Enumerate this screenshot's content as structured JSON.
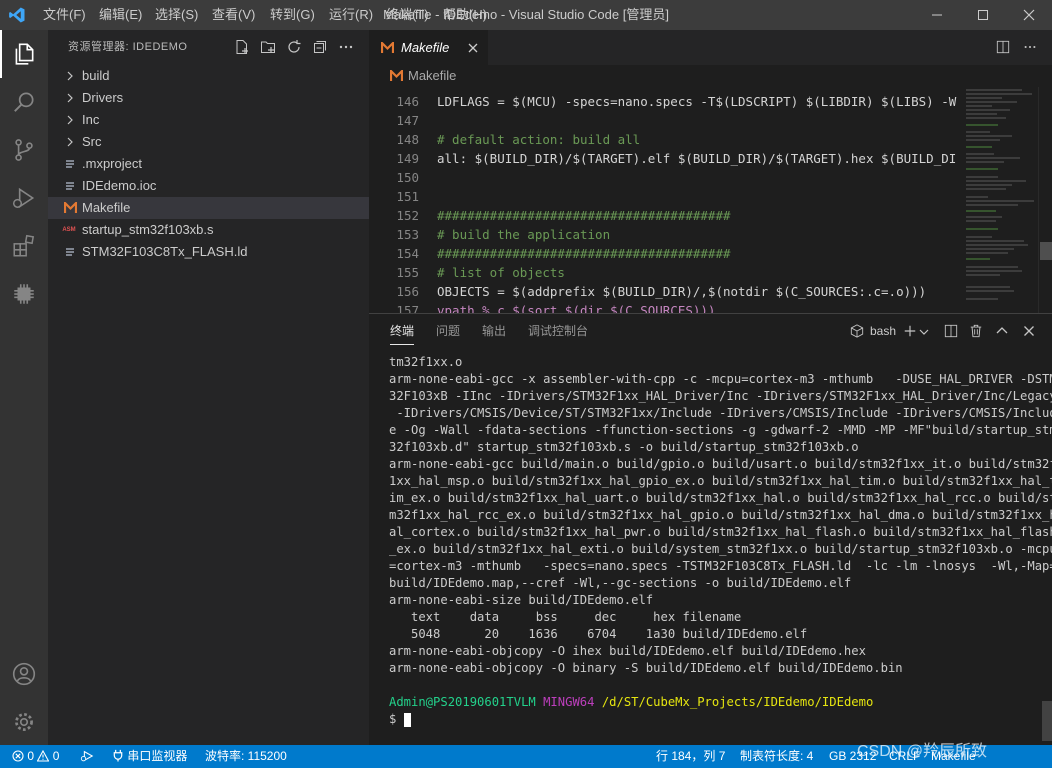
{
  "window": {
    "title": "Makefile - IDEdemo - Visual Studio Code [管理员]",
    "menu": [
      "文件(F)",
      "编辑(E)",
      "选择(S)",
      "查看(V)",
      "转到(G)",
      "运行(R)",
      "终端(T)",
      "帮助(H)"
    ]
  },
  "sidebar": {
    "title": "资源管理器: IDEDEMO",
    "items": [
      {
        "label": "build",
        "type": "folder"
      },
      {
        "label": "Drivers",
        "type": "folder"
      },
      {
        "label": "Inc",
        "type": "folder"
      },
      {
        "label": "Src",
        "type": "folder"
      },
      {
        "label": ".mxproject",
        "type": "file"
      },
      {
        "label": "IDEdemo.ioc",
        "type": "file"
      },
      {
        "label": "Makefile",
        "type": "makefile",
        "selected": true
      },
      {
        "label": "startup_stm32f103xb.s",
        "type": "asm"
      },
      {
        "label": "STM32F103C8Tx_FLASH.ld",
        "type": "file"
      }
    ]
  },
  "editor": {
    "tab_label": "Makefile",
    "breadcrumb": "Makefile",
    "lines": [
      {
        "num": "146",
        "text": "LDFLAGS = $(MCU) -specs=nano.specs -T$(LDSCRIPT) $(LIBDIR) $(LIBS) -W"
      },
      {
        "num": "147",
        "text": ""
      },
      {
        "num": "148",
        "text": "# default action: build all"
      },
      {
        "num": "149",
        "text": "all: $(BUILD_DIR)/$(TARGET).elf $(BUILD_DIR)/$(TARGET).hex $(BUILD_DI"
      },
      {
        "num": "150",
        "text": ""
      },
      {
        "num": "151",
        "text": ""
      },
      {
        "num": "152",
        "text": "#######################################"
      },
      {
        "num": "153",
        "text": "# build the application"
      },
      {
        "num": "154",
        "text": "#######################################"
      },
      {
        "num": "155",
        "text": "# list of objects"
      },
      {
        "num": "156",
        "text": "OBJECTS = $(addprefix $(BUILD_DIR)/,$(notdir $(C_SOURCES:.c=.o)))"
      },
      {
        "num": "157",
        "text": "vpath %.c $(sort $(dir $(C_SOURCES)))"
      }
    ]
  },
  "panel": {
    "tabs": [
      "终端",
      "问题",
      "输出",
      "调试控制台"
    ],
    "shell": "bash",
    "terminal_lines": [
      "tm32f1xx.o",
      "arm-none-eabi-gcc -x assembler-with-cpp -c -mcpu=cortex-m3 -mthumb   -DUSE_HAL_DRIVER -DSTM",
      "32F103xB -IInc -IDrivers/STM32F1xx_HAL_Driver/Inc -IDrivers/STM32F1xx_HAL_Driver/Inc/Legacy",
      " -IDrivers/CMSIS/Device/ST/STM32F1xx/Include -IDrivers/CMSIS/Include -IDrivers/CMSIS/Includ",
      "e -Og -Wall -fdata-sections -ffunction-sections -g -gdwarf-2 -MMD -MP -MF\"build/startup_stm",
      "32f103xb.d\" startup_stm32f103xb.s -o build/startup_stm32f103xb.o",
      "arm-none-eabi-gcc build/main.o build/gpio.o build/usart.o build/stm32f1xx_it.o build/stm32f",
      "1xx_hal_msp.o build/stm32f1xx_hal_gpio_ex.o build/stm32f1xx_hal_tim.o build/stm32f1xx_hal_t",
      "im_ex.o build/stm32f1xx_hal_uart.o build/stm32f1xx_hal.o build/stm32f1xx_hal_rcc.o build/st",
      "m32f1xx_hal_rcc_ex.o build/stm32f1xx_hal_gpio.o build/stm32f1xx_hal_dma.o build/stm32f1xx_h",
      "al_cortex.o build/stm32f1xx_hal_pwr.o build/stm32f1xx_hal_flash.o build/stm32f1xx_hal_flash",
      "_ex.o build/stm32f1xx_hal_exti.o build/system_stm32f1xx.o build/startup_stm32f103xb.o -mcpu",
      "=cortex-m3 -mthumb   -specs=nano.specs -TSTM32F103C8Tx_FLASH.ld  -lc -lm -lnosys  -Wl,-Map=",
      "build/IDEdemo.map,--cref -Wl,--gc-sections -o build/IDEdemo.elf",
      "arm-none-eabi-size build/IDEdemo.elf",
      "   text    data     bss     dec     hex filename",
      "   5048      20    1636    6704    1a30 build/IDEdemo.elf",
      "arm-none-eabi-objcopy -O ihex build/IDEdemo.elf build/IDEdemo.hex",
      "arm-none-eabi-objcopy -O binary -S build/IDEdemo.elf build/IDEdemo.bin",
      ""
    ],
    "prompt_user": "Admin@PS20190601TVLM",
    "prompt_env": "MINGW64",
    "prompt_path": "/d/ST/CubeMx_Projects/IDEdemo/IDEdemo",
    "prompt_symbol": "$"
  },
  "statusbar": {
    "errors": "0",
    "warnings": "0",
    "serial": "串口监视器",
    "baud": "波特率: 115200",
    "position": "行 184，列 7",
    "tabsize": "制表符长度: 4",
    "encoding": "GB 2312",
    "eol": "CRLF",
    "language": "Makefile"
  },
  "watermark": "CSDN @羚辰所致",
  "colors": {
    "accent": "#007acc",
    "titlebar": "#3c3c3c",
    "activitybar": "#333333",
    "sidebar": "#252526",
    "editor": "#1e1e1e",
    "makefile_icon": "#e37933",
    "prompt_user": "#23d18b",
    "prompt_env": "#bc3fbc",
    "prompt_path": "#e5e510"
  }
}
